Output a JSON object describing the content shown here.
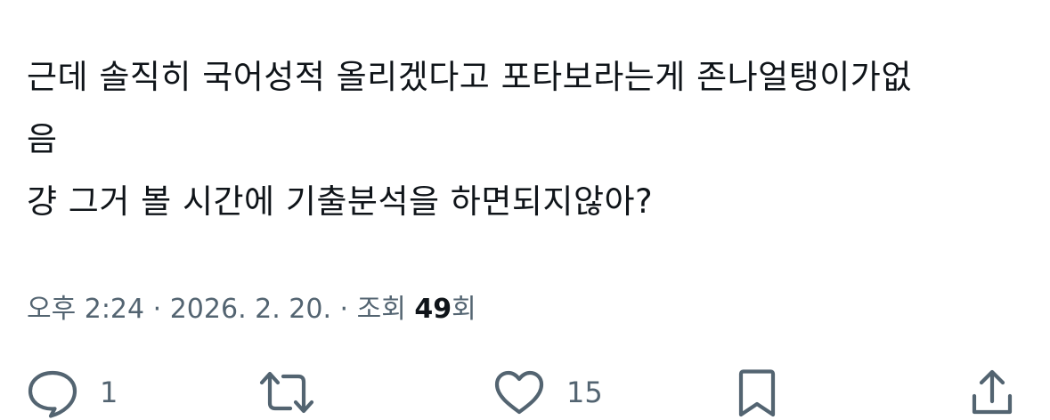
{
  "tweet": {
    "lines": [
      "근데 솔직히 국어성적 올리겠다고 포타보라는게 존나얼탱이가없",
      "음",
      "걍 그거 볼 시간에 기출분석을 하면되지않아?"
    ]
  },
  "meta": {
    "time": "오후 2:24",
    "separator": " · ",
    "date": "2026. 2. 20.",
    "views_label": "조회",
    "views_count": "49",
    "views_suffix": "회"
  },
  "actions": {
    "reply_count": "1",
    "like_count": "15",
    "icons": [
      "reply-icon",
      "retweet-icon",
      "like-icon",
      "bookmark-icon",
      "share-icon"
    ],
    "icon_color": "#536471"
  }
}
